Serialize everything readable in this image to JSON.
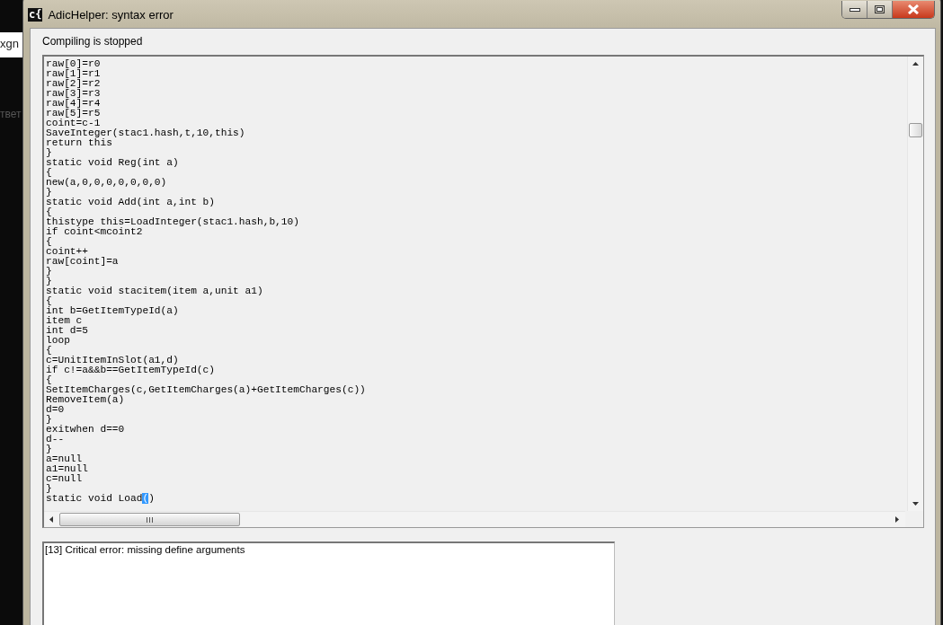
{
  "background": {
    "tab_text": "xgn",
    "side_text": "твет"
  },
  "window": {
    "icon_label": "c{",
    "title": "AdicHelper: syntax error"
  },
  "status": "Compiling is stopped",
  "code_lines": [
    {
      "text": "raw[0]=r0"
    },
    {
      "text": "raw[1]=r1"
    },
    {
      "text": "raw[2]=r2"
    },
    {
      "text": "raw[3]=r3"
    },
    {
      "text": "raw[4]=r4"
    },
    {
      "text": "raw[5]=r5"
    },
    {
      "text": "coint=c-1"
    },
    {
      "text": "SaveInteger(stac1.hash,t,10,this)"
    },
    {
      "text": "return this"
    },
    {
      "text": "}"
    },
    {
      "text": "static void Reg(int a)"
    },
    {
      "text": "{"
    },
    {
      "text": "new(a,0,0,0,0,0,0,0)"
    },
    {
      "text": "}"
    },
    {
      "text": "static void Add(int a,int b)"
    },
    {
      "text": "{"
    },
    {
      "text": "thistype this=LoadInteger(stac1.hash,b,10)"
    },
    {
      "text": "if coint<mcoint2"
    },
    {
      "text": "{"
    },
    {
      "text": "coint++"
    },
    {
      "text": "raw[coint]=a"
    },
    {
      "text": "}"
    },
    {
      "text": "}"
    },
    {
      "text": "static void stacitem(item a,unit a1)"
    },
    {
      "text": "{"
    },
    {
      "text": "int b=GetItemTypeId(a)"
    },
    {
      "text": "item c"
    },
    {
      "text": "int d=5"
    },
    {
      "text": "loop"
    },
    {
      "text": "{"
    },
    {
      "text": "c=UnitItemInSlot(a1,d)"
    },
    {
      "text": "if c!=a&&b==GetItemTypeId(c)"
    },
    {
      "text": "{"
    },
    {
      "text": "SetItemCharges(c,GetItemCharges(a)+GetItemCharges(c))"
    },
    {
      "text": "RemoveItem(a)"
    },
    {
      "text": "d=0"
    },
    {
      "text": "}"
    },
    {
      "text": "exitwhen d==0"
    },
    {
      "text": "d--"
    },
    {
      "text": "}"
    },
    {
      "text": "a=null"
    },
    {
      "text": "a1=null"
    },
    {
      "text": "c=null"
    },
    {
      "text": "}"
    },
    {
      "text": "static void Load",
      "highlight": "(",
      "rest": ")"
    }
  ],
  "errors": [
    "[13] Critical error: missing define arguments"
  ]
}
